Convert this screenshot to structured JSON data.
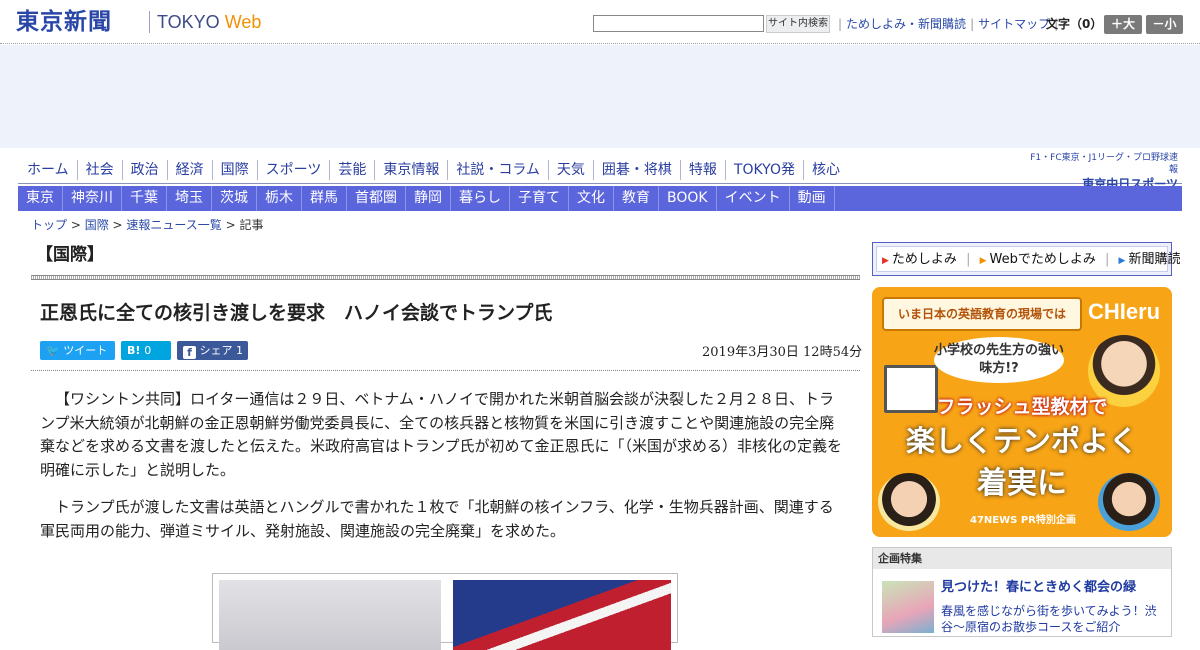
{
  "header": {
    "logo_ja": "東京新聞",
    "logo_en_main": "TOKYO",
    "logo_en_web": "Web",
    "search_value": "",
    "search_button": "サイト内検索",
    "util_links": [
      "ためしよみ・新聞購読",
      "サイトマップ"
    ],
    "font_size_label": "文字（0）",
    "font_larger": "＋大",
    "font_smaller": "－小"
  },
  "nav_primary": [
    "ホーム",
    "社会",
    "政治",
    "経済",
    "国際",
    "スポーツ",
    "芸能",
    "東京情報",
    "社説・コラム",
    "天気",
    "囲碁・将棋",
    "特報",
    "TOKYO発",
    "核心"
  ],
  "chunichi": {
    "tagline": "F1・FC東京・J1リーグ・プロ野球速報",
    "brand": "東京中日スポーツ"
  },
  "nav_regional": [
    "東京",
    "神奈川",
    "千葉",
    "埼玉",
    "茨城",
    "栃木",
    "群馬",
    "首都圏",
    "静岡",
    "暮らし",
    "子育て",
    "文化",
    "教育",
    "BOOK",
    "イベント",
    "動画"
  ],
  "breadcrumb": {
    "items": [
      "トップ",
      "国際",
      "速報ニュース一覧"
    ],
    "current": "記事"
  },
  "article": {
    "section": "【国際】",
    "headline": "正恩氏に全ての核引き渡しを要求　ハノイ会談でトランプ氏",
    "date": "2019年3月30日 12時54分",
    "share": {
      "tweet": "ツイート",
      "hatena_icon": "B!",
      "hatena_count": "0",
      "fb_label": "シェア",
      "fb_count": "1"
    },
    "paragraphs": [
      "【ワシントン共同】ロイター通信は２９日、ベトナム・ハノイで開かれた米朝首脳会談が決裂した２月２８日、トランプ米大統領が北朝鮮の金正恩朝鮮労働党委員長に、全ての核兵器と核物質を米国に引き渡すことや関連施設の完全廃棄などを求める文書を渡したと伝えた。米政府高官はトランプ氏が初めて金正恩氏に「（米国が求める）非核化の定義を明確に示した」と説明した。",
      "トランプ氏が渡した文書は英語とハングルで書かれた１枚で「北朝鮮の核インフラ、化学・生物兵器計画、関連する軍民両用の能力、弾道ミサイル、発射施設、関連施設の完全廃棄」を求めた。"
    ]
  },
  "sidebar": {
    "subscribe_links": [
      "ためしよみ",
      "Webでためしよみ",
      "新聞購読"
    ],
    "promo": {
      "banner": "いま日本の英語教育の現場では",
      "brand": "CHIeru",
      "question": "小学校の先生方の強い味方!?",
      "red_line": "フラッシュ型教材で",
      "big_line1": "楽しくテンポよく",
      "big_line2": "着実に",
      "footer": "47NEWS PR特別企画"
    },
    "feature": {
      "header": "企画特集",
      "title": "見つけた！春にときめく都会の緑",
      "desc": "春風を感じながら街を歩いてみよう！渋谷～原宿のお散歩コースをご紹介"
    }
  },
  "colors": {
    "brand_blue": "#2a47a8",
    "nav_blue": "#5b65dc",
    "twitter": "#1da1f2",
    "hatena": "#00a4de",
    "facebook": "#3b5998",
    "promo_orange": "#f7a417"
  }
}
